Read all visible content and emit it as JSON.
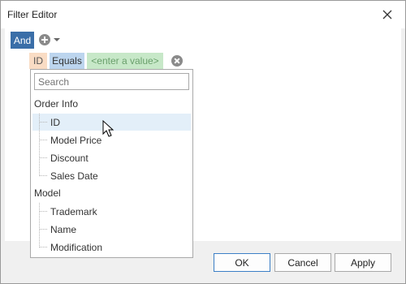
{
  "window": {
    "title": "Filter Editor"
  },
  "group": {
    "operator": "And"
  },
  "condition": {
    "field": "ID",
    "operator": "Equals",
    "value_placeholder": "<enter a value>"
  },
  "dropdown": {
    "search_placeholder": "Search",
    "groups": [
      {
        "label": "Order Info",
        "items": [
          "ID",
          "Model Price",
          "Discount",
          "Sales Date"
        ],
        "selected": "ID"
      },
      {
        "label": "Model",
        "items": [
          "Trademark",
          "Name",
          "Modification"
        ]
      }
    ]
  },
  "buttons": {
    "ok": "OK",
    "cancel": "Cancel",
    "apply": "Apply"
  },
  "icons": {
    "close": "close-icon",
    "add": "add-circle-icon",
    "dropdown_caret": "chevron-down-icon",
    "remove": "remove-icon",
    "cursor": "mouse-pointer-icon"
  },
  "colors": {
    "accent": "#3a6ea8",
    "field_bg": "#f9dcc4",
    "operator_bg": "#bcd5ee",
    "value_bg": "#c7e8c8",
    "selection_bg": "#e3eff9"
  }
}
